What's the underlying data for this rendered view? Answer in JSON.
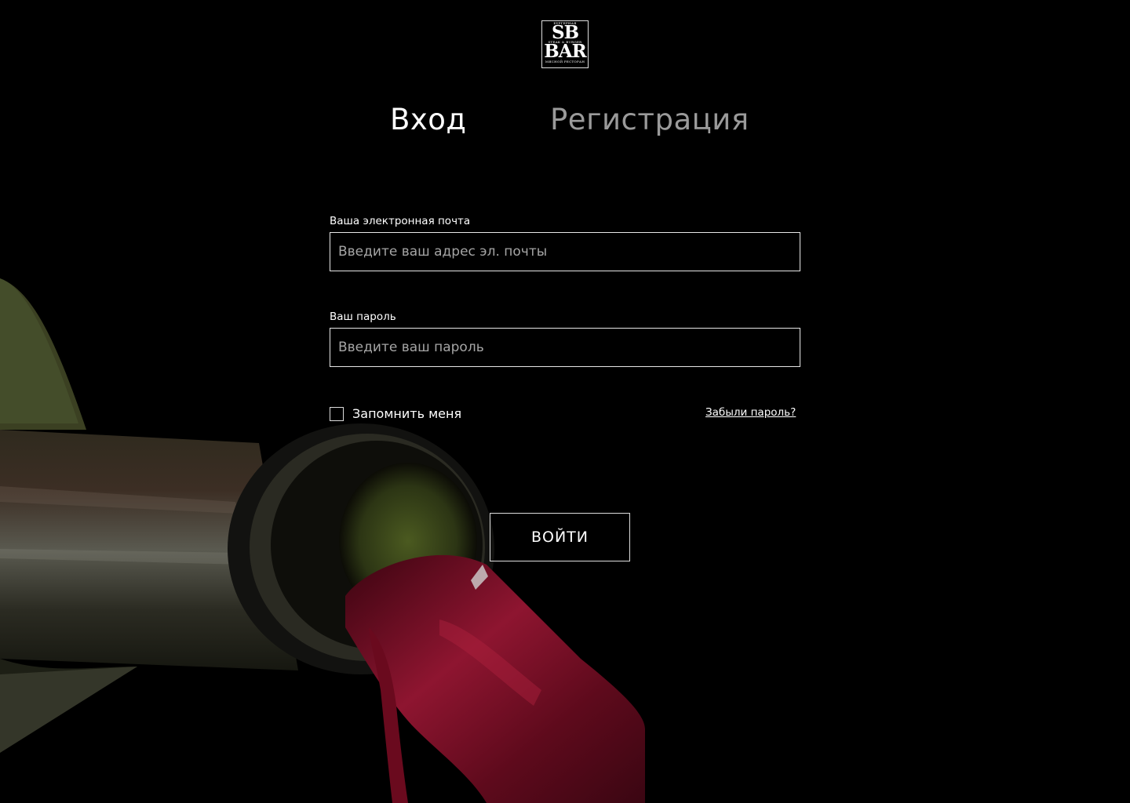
{
  "logo": {
    "top_text": "БУРГЕРНАЯ",
    "line1": "SB",
    "middle_text": "STEAK & BURGER",
    "line2": "BAR",
    "bottom_text": "МЯСНОЙ РЕСТОРАН"
  },
  "tabs": {
    "login": "Вход",
    "register": "Регистрация",
    "active": "login"
  },
  "form": {
    "email_label": "Ваша электронная почта",
    "email_placeholder": "Введите ваш адрес эл. почты",
    "email_value": "",
    "password_label": "Ваш пароль",
    "password_placeholder": "Введите ваш пароль",
    "password_value": "",
    "remember_label": "Запомнить меня",
    "remember_checked": false,
    "forgot_link": "Забыли пароль?",
    "submit_label": "ВОЙТИ"
  },
  "colors": {
    "background": "#000000",
    "text": "#ffffff",
    "inactive_tab": "#9a9a9a",
    "wine": "#7a0e22",
    "bottle": "#2e3320"
  },
  "icons": {
    "background": "wine-bottle-pouring-illustration"
  }
}
